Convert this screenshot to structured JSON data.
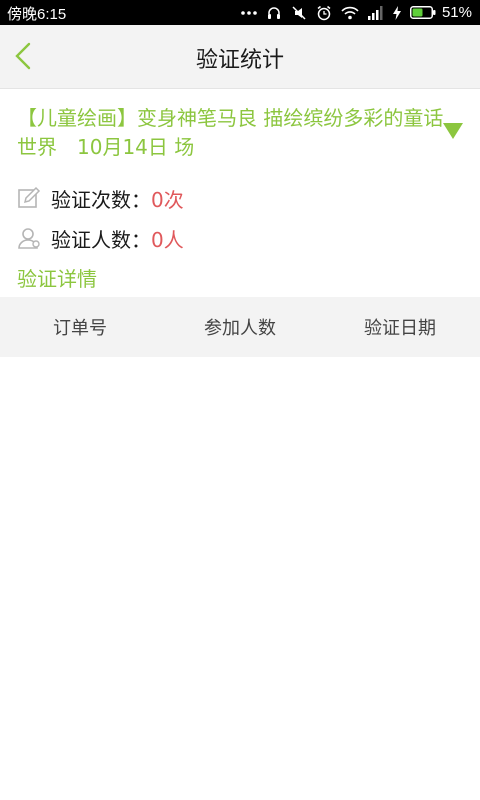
{
  "status_bar": {
    "time": "傍晚6:15",
    "battery_percent": "51%"
  },
  "header": {
    "title": "验证统计"
  },
  "event": {
    "title": "【儿童绘画】变身神笔马良 描绘缤纷多彩的童话世界　10月14日 场"
  },
  "stats": {
    "verify_count_label": "验证次数：",
    "verify_count_value": "0次",
    "verify_people_label": "验证人数：",
    "verify_people_value": "0人"
  },
  "detail_link": "验证详情",
  "table": {
    "columns": [
      "订单号",
      "参加人数",
      "验证日期"
    ],
    "rows": []
  },
  "colors": {
    "accent": "#8cc63f",
    "value": "#e0585b",
    "header_bg": "#f3f3f3"
  }
}
